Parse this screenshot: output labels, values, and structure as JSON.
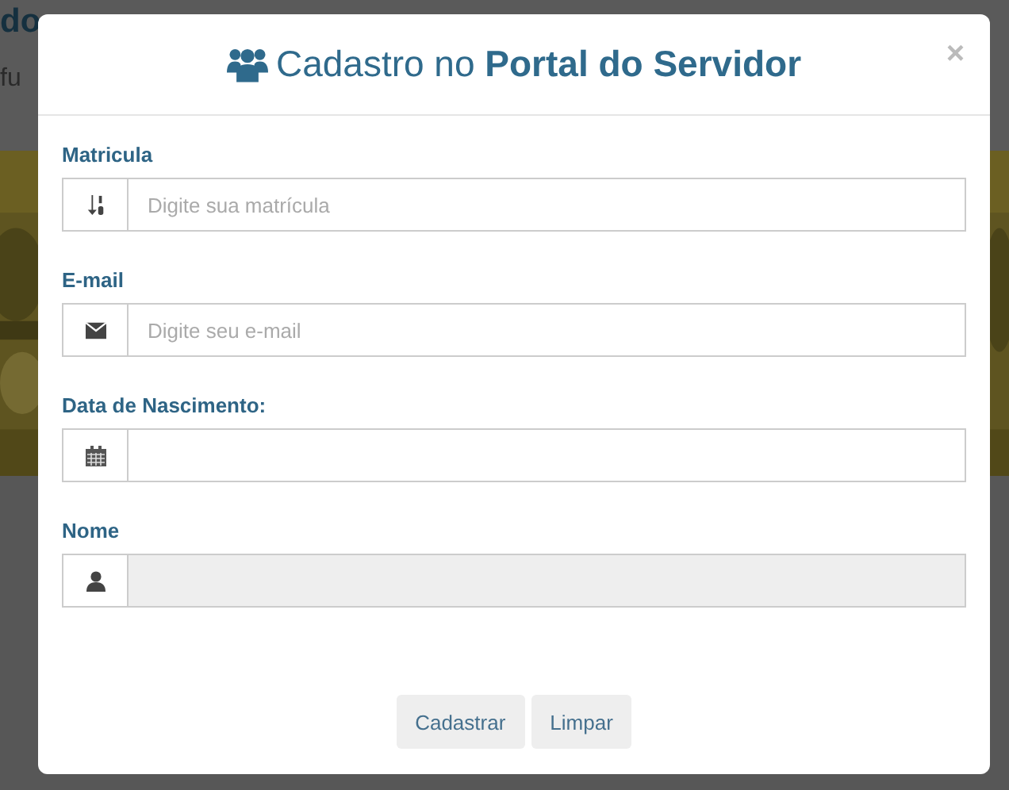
{
  "background": {
    "heading": "do",
    "subtitle": "fu"
  },
  "modal": {
    "title": "Cadastro no **Portal do Servidor**",
    "close": "×",
    "fields": [
      {
        "label": "Matricula",
        "placeholder": "Digite sua matrícula",
        "disabled": false
      },
      {
        "label": "E-mail",
        "placeholder": "Digite seu e-mail",
        "disabled": false
      },
      {
        "label": "Data de Nascimento:",
        "disabled": false
      },
      {
        "label": "Nome",
        "disabled": true
      }
    ],
    "buttons": [
      "Cadastrar",
      "Limpar"
    ]
  }
}
